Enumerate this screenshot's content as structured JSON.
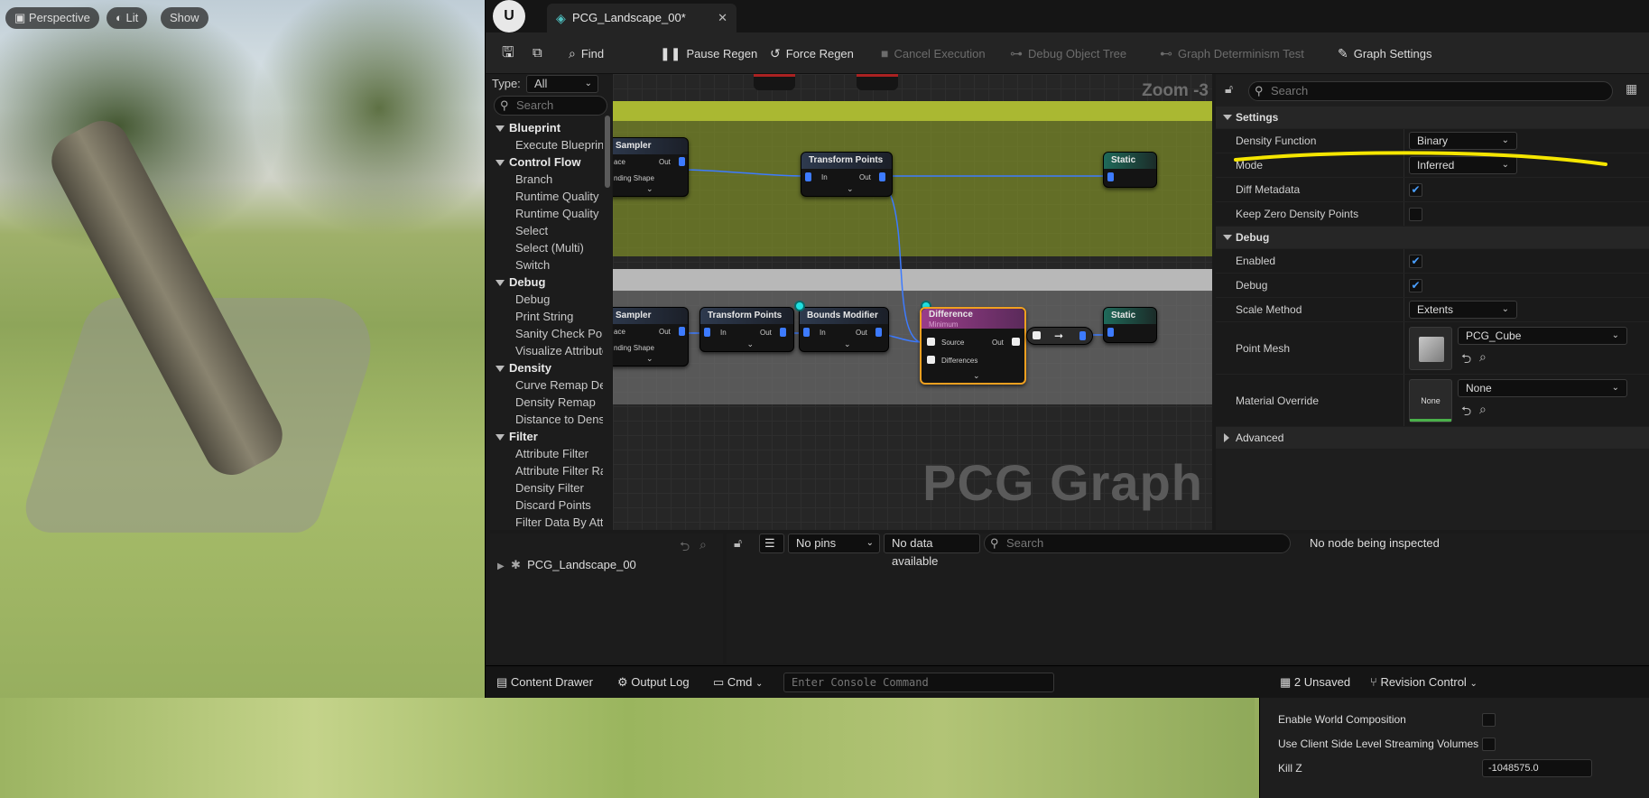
{
  "viewport": {
    "perspective_label": "Perspective",
    "lit_label": "Lit",
    "show_label": "Show"
  },
  "titlebar": {
    "tab_label": "PCG_Landscape_00*"
  },
  "toolbar": {
    "find": "Find",
    "pause_regen": "Pause Regen",
    "force_regen": "Force Regen",
    "cancel_execution": "Cancel Execution",
    "debug_object_tree": "Debug Object Tree",
    "graph_determinism_test": "Graph Determinism Test",
    "graph_settings": "Graph Settings"
  },
  "palette": {
    "type_label": "Type:",
    "type_value": "All",
    "search_placeholder": "Search",
    "rows": [
      {
        "kind": "cat",
        "label": "Blueprint"
      },
      {
        "kind": "item",
        "label": "Execute Blueprint"
      },
      {
        "kind": "cat",
        "label": "Control Flow"
      },
      {
        "kind": "item",
        "label": "Branch"
      },
      {
        "kind": "item",
        "label": "Runtime Quality"
      },
      {
        "kind": "item",
        "label": "Runtime Quality"
      },
      {
        "kind": "item",
        "label": "Select"
      },
      {
        "kind": "item",
        "label": "Select (Multi)"
      },
      {
        "kind": "item",
        "label": "Switch"
      },
      {
        "kind": "cat",
        "label": "Debug"
      },
      {
        "kind": "item",
        "label": "Debug"
      },
      {
        "kind": "item",
        "label": "Print String"
      },
      {
        "kind": "item",
        "label": "Sanity Check Point"
      },
      {
        "kind": "item",
        "label": "Visualize Attribute"
      },
      {
        "kind": "cat",
        "label": "Density"
      },
      {
        "kind": "item",
        "label": "Curve Remap Density"
      },
      {
        "kind": "item",
        "label": "Density Remap"
      },
      {
        "kind": "item",
        "label": "Distance to Density"
      },
      {
        "kind": "cat",
        "label": "Filter"
      },
      {
        "kind": "item",
        "label": "Attribute Filter"
      },
      {
        "kind": "item",
        "label": "Attribute Filter Range"
      },
      {
        "kind": "item",
        "label": "Density Filter"
      },
      {
        "kind": "item",
        "label": "Discard Points"
      },
      {
        "kind": "item",
        "label": "Filter Data By Attribute"
      }
    ]
  },
  "graph": {
    "zoom": "Zoom -3",
    "watermark": "PCG Graph",
    "nodes": {
      "sampler_top": {
        "title": "Sampler",
        "in": "ace",
        "out": "Out",
        "extra": "nding Shape"
      },
      "transform_top": {
        "title": "Transform Points",
        "in": "In",
        "out": "Out"
      },
      "static_top": {
        "title": "Static"
      },
      "sampler_bot": {
        "title": "Sampler",
        "in": "ace",
        "out": "Out",
        "extra": "nding Shape"
      },
      "transform_bot": {
        "title": "Transform Points",
        "in": "In",
        "out": "Out"
      },
      "bounds": {
        "title": "Bounds Modifier",
        "in": "In",
        "out": "Out"
      },
      "difference": {
        "title": "Difference",
        "sub": "Minimum",
        "source": "Source",
        "out": "Out",
        "diffs": "Differences"
      },
      "static_bot": {
        "title": "Static"
      }
    }
  },
  "details": {
    "search_placeholder": "Search",
    "settings_header": "Settings",
    "density_function_label": "Density Function",
    "density_function_value": "Binary",
    "mode_label": "Mode",
    "mode_value": "Inferred",
    "diff_metadata_label": "Diff Metadata",
    "diff_metadata_checked": true,
    "keep_zero_label": "Keep Zero Density Points",
    "keep_zero_checked": false,
    "debug_header": "Debug",
    "enabled_label": "Enabled",
    "enabled_checked": true,
    "debug_label": "Debug",
    "debug_checked": true,
    "scale_method_label": "Scale Method",
    "scale_method_value": "Extents",
    "point_mesh_label": "Point Mesh",
    "point_mesh_value": "PCG_Cube",
    "material_override_label": "Material Override",
    "material_override_value": "None",
    "material_thumb_text": "None",
    "advanced_header": "Advanced"
  },
  "outliner": {
    "item_label": "PCG_Landscape_00"
  },
  "inspector": {
    "pins_value": "No pins",
    "data_value": "No data available",
    "search_placeholder": "Search",
    "status": "No node being inspected"
  },
  "statusbar": {
    "content_drawer": "Content Drawer",
    "output_log": "Output Log",
    "cmd": "Cmd",
    "console_placeholder": "Enter Console Command",
    "unsaved": "2 Unsaved",
    "revision_control": "Revision Control"
  },
  "world_settings": {
    "enable_world_composition": "Enable World Composition",
    "client_side_streaming": "Use Client Side Level Streaming Volumes",
    "kill_z_label": "Kill Z",
    "kill_z_value": "-1048575.0"
  },
  "colors": {
    "accent_yellow": "#f5e600",
    "pin_blue": "#3d7bff",
    "selection_orange": "#f0a020",
    "check_blue": "#4a9fff"
  }
}
